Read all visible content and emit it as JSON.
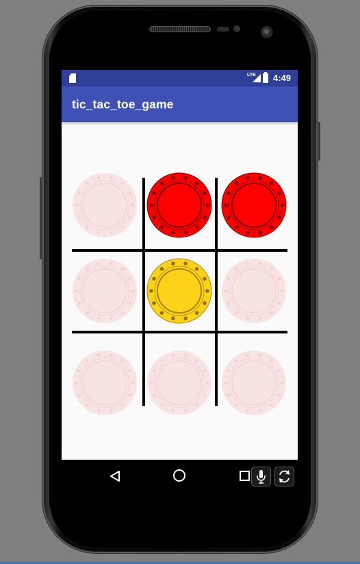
{
  "status_bar": {
    "time": "4:49",
    "network_label": "LTE",
    "icons": [
      "sd-card-icon",
      "signal-icon",
      "battery-icon"
    ]
  },
  "app_bar": {
    "title": "tic_tac_toe_game"
  },
  "board": {
    "rows": [
      [
        "empty",
        "red",
        "red"
      ],
      [
        "empty",
        "yellow",
        "empty"
      ],
      [
        "empty",
        "empty",
        "empty"
      ]
    ]
  },
  "colors": {
    "status_bar": "#2f3e97",
    "app_bar": "#3f51b5",
    "red_chip": "#ff0000",
    "yellow_chip": "#ffd21a",
    "empty_chip": "#f8e3e3",
    "grid_line": "#000000"
  },
  "nav_bar": {
    "buttons": [
      "back-icon",
      "home-icon",
      "recent-apps-icon"
    ],
    "emulator_tools": [
      "microphone-icon",
      "rotate-icon"
    ]
  }
}
